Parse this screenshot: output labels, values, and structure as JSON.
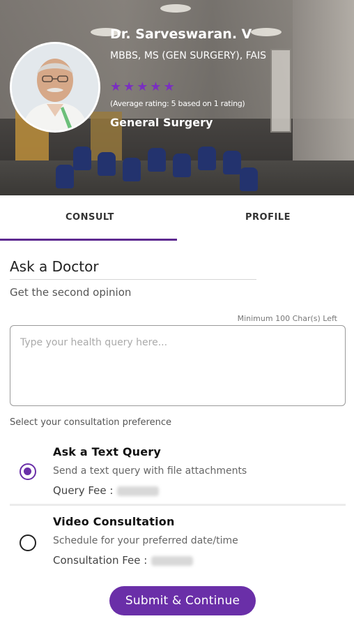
{
  "header": {
    "doctor_name": "Dr. Sarveswaran. V",
    "degree": "MBBS, MS (GEN SURGERY), FAIS",
    "rating_value": 5,
    "rating_text": "(Average rating: 5 based on 1 rating)",
    "specialty": "General Surgery",
    "star_color": "#7a2fc0",
    "stars": [
      "star-icon",
      "star-icon",
      "star-icon",
      "star-icon",
      "star-icon"
    ]
  },
  "tabs": [
    {
      "label": "CONSULT",
      "active": true
    },
    {
      "label": "PROFILE",
      "active": false
    }
  ],
  "consult": {
    "title": "Ask a Doctor",
    "subtitle": "Get the second opinion",
    "min_chars": "Minimum 100 Char(s) Left",
    "query_placeholder": "Type your health query here...",
    "preference_label": "Select your consultation preference",
    "options": [
      {
        "title": "Ask a Text Query",
        "description": "Send a text query with file attachments",
        "fee_label": "Query Fee :",
        "selected": true
      },
      {
        "title": "Video Consultation",
        "description": "Schedule for your preferred date/time",
        "fee_label": "Consultation Fee :",
        "selected": false
      }
    ],
    "submit_label": "Submit & Continue"
  },
  "theme": {
    "accent": "#6a2fa8",
    "tab_indicator": "#5e2a90"
  }
}
